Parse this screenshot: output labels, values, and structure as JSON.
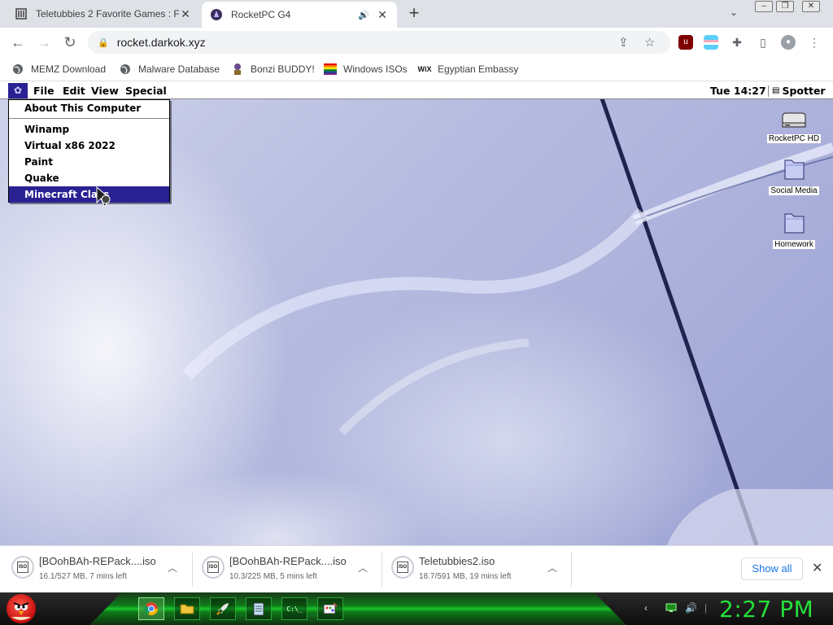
{
  "browser": {
    "tabs": [
      {
        "title": "Teletubbies 2 Favorite Games : Fr",
        "favicon": "library-icon",
        "active": false
      },
      {
        "title": "RocketPC G4",
        "favicon": "rocketpc-icon",
        "active": true,
        "audio": true
      }
    ],
    "new_tab": "+",
    "address": "rocket.darkok.xyz"
  },
  "bookmarks": [
    {
      "label": "MEMZ Download",
      "icon": "globe-icon"
    },
    {
      "label": "Malware Database",
      "icon": "globe-icon"
    },
    {
      "label": "Bonzi BUDDY!",
      "icon": "bonzi-icon"
    },
    {
      "label": "Windows ISOs",
      "icon": "rainbow-flag-icon"
    },
    {
      "label": "Egyptian Embassy",
      "icon": "wix-icon"
    }
  ],
  "wix_text": "WiX",
  "desktop": {
    "menubar": {
      "apple_glyph": "✿",
      "menus": [
        "File",
        "Edit",
        "View",
        "Special"
      ],
      "clock": "Tue 14:27",
      "app": "Spotter"
    },
    "apple_menu": {
      "items": [
        "About This Computer",
        "Winamp",
        "Virtual x86 2022",
        "Paint",
        "Quake",
        "Minecraft Class"
      ],
      "highlighted_index": 5
    },
    "icons": [
      {
        "label": "RocketPC HD",
        "icon": "hard-drive-icon"
      },
      {
        "label": "Social Media",
        "icon": "folder-icon"
      },
      {
        "label": "Homework",
        "icon": "folder-icon"
      }
    ]
  },
  "downloads": [
    {
      "name": "[BOohBAh-REPack....iso",
      "status": "16.1/527 MB, 7 mins left"
    },
    {
      "name": "[BOohBAh-REPack....iso",
      "status": "10.3/225 MB, 5 mins left"
    },
    {
      "name": "Teletubbies2.iso",
      "status": "18.7/591 MB, 19 mins left"
    }
  ],
  "iso_icon_text": "ISO",
  "show_all": "Show all",
  "taskbar": {
    "clock": "2:27 PM",
    "apps": [
      "chrome-icon",
      "folder-icon",
      "rocket-icon",
      "notepad-icon",
      "terminal-icon",
      "paint-icon"
    ],
    "terminal_text": "C:\\_"
  },
  "colors": {
    "mac_highlight": "#2a2193",
    "taskbar_green": "#26e03a",
    "link_blue": "#1a73e8"
  }
}
